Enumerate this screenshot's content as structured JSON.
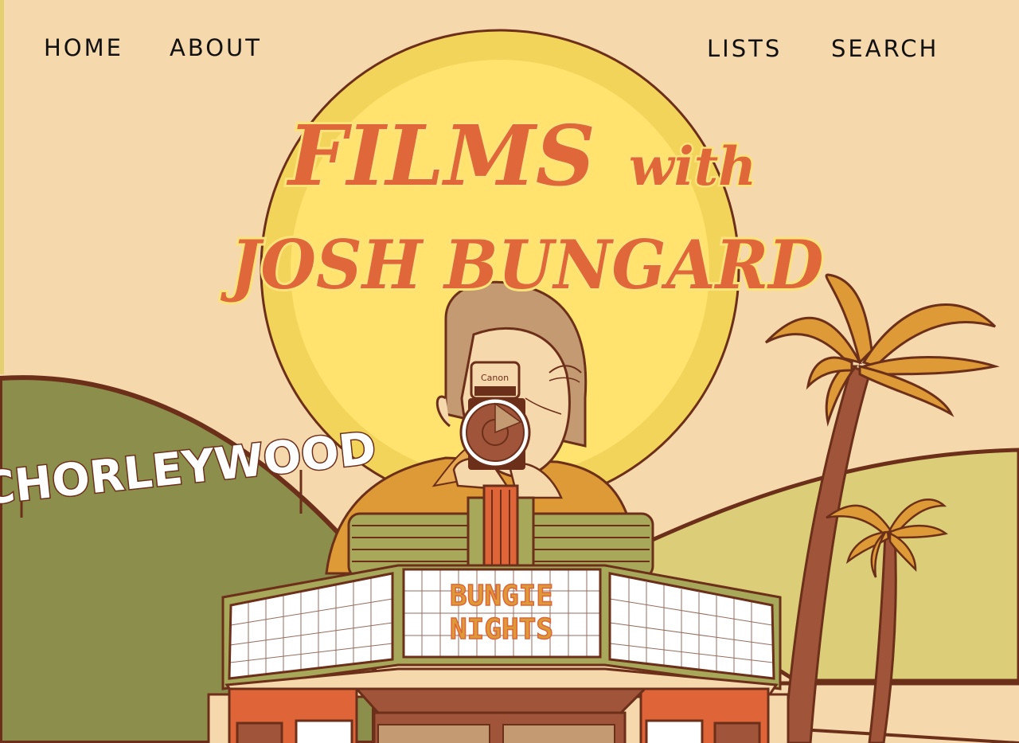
{
  "nav": {
    "home": "HOME",
    "about": "ABOUT",
    "lists": "LISTS",
    "search": "SEARCH"
  },
  "hero": {
    "title_line1_a": "FILMS",
    "title_line1_b": "with",
    "title_line2": "JOSH BUNGARD",
    "hill_sign": "CHORLEYWOOD",
    "camera_brand": "Canon",
    "marquee_line1": "BUNGIE",
    "marquee_line2": "NIGHTS"
  },
  "colors": {
    "background": "#f6d8ad",
    "title": "#e0673a",
    "title_outline": "#fbe37a",
    "sun": "#ffe36e",
    "sun_ring": "#f2d45a",
    "hill_left": "#8c8f4b",
    "hill_right": "#dccd78",
    "palm_leaves": "#de9a36",
    "outline": "#6b2f1a",
    "theater_red": "#df6538"
  }
}
